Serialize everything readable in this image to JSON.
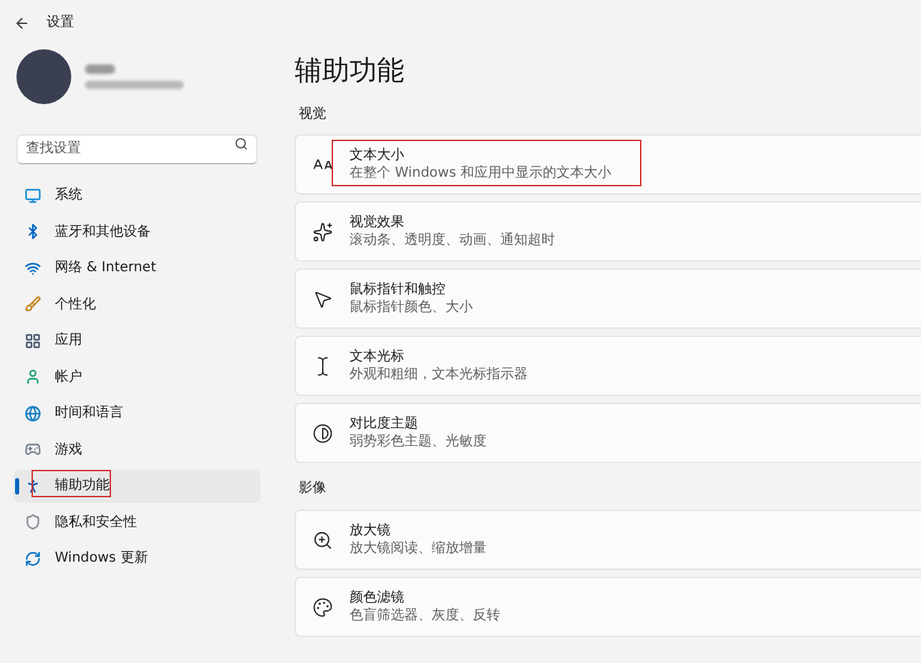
{
  "window": {
    "title": "设置"
  },
  "search": {
    "placeholder": "查找设置"
  },
  "sidebar": {
    "items": [
      {
        "label": "系统",
        "selected": false,
        "annotated": false
      },
      {
        "label": "蓝牙和其他设备",
        "selected": false,
        "annotated": false
      },
      {
        "label": "网络 & Internet",
        "selected": false,
        "annotated": false
      },
      {
        "label": "个性化",
        "selected": false,
        "annotated": false
      },
      {
        "label": "应用",
        "selected": false,
        "annotated": false
      },
      {
        "label": "帐户",
        "selected": false,
        "annotated": false
      },
      {
        "label": "时间和语言",
        "selected": false,
        "annotated": false
      },
      {
        "label": "游戏",
        "selected": false,
        "annotated": false
      },
      {
        "label": "辅助功能",
        "selected": true,
        "annotated": true
      },
      {
        "label": "隐私和安全性",
        "selected": false,
        "annotated": false
      },
      {
        "label": "Windows 更新",
        "selected": false,
        "annotated": false
      }
    ]
  },
  "page": {
    "title": "辅助功能",
    "sections": [
      {
        "heading": "视觉",
        "cards": [
          {
            "title": "文本大小",
            "subtitle": "在整个 Windows 和应用中显示的文本大小",
            "annotated": true
          },
          {
            "title": "视觉效果",
            "subtitle": "滚动条、透明度、动画、通知超时",
            "annotated": false
          },
          {
            "title": "鼠标指针和触控",
            "subtitle": "鼠标指针颜色、大小",
            "annotated": false
          },
          {
            "title": "文本光标",
            "subtitle": "外观和粗细，文本光标指示器",
            "annotated": false
          },
          {
            "title": "对比度主题",
            "subtitle": "弱势彩色主题、光敏度",
            "annotated": false
          }
        ]
      },
      {
        "heading": "影像",
        "cards": [
          {
            "title": "放大镜",
            "subtitle": "放大镜阅读、缩放增量",
            "annotated": false
          },
          {
            "title": "颜色滤镜",
            "subtitle": "色盲筛选器、灰度、反转",
            "annotated": false
          }
        ]
      }
    ]
  }
}
